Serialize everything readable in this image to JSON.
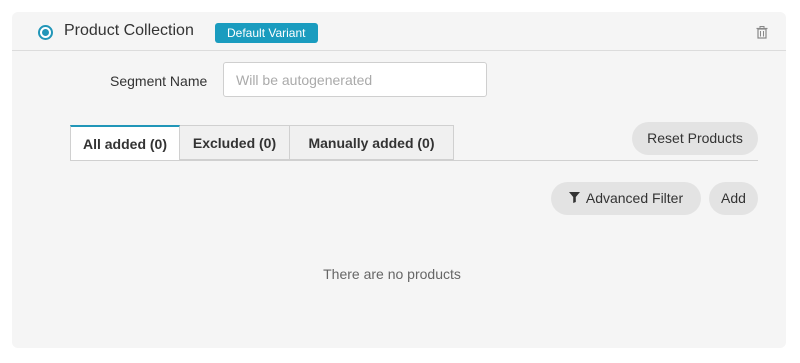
{
  "header": {
    "title": "Product Collection",
    "badge": "Default Variant",
    "radio_selected": true,
    "delete_icon": "trash-icon"
  },
  "segment": {
    "label": "Segment Name",
    "value": "",
    "placeholder": "Will be autogenerated"
  },
  "tabs": [
    {
      "label": "All added (0)",
      "active": true
    },
    {
      "label": "Excluded (0)",
      "active": false
    },
    {
      "label": "Manually added (0)",
      "active": false
    }
  ],
  "actions": {
    "reset_label": "Reset Products",
    "filter_label": "Advanced Filter",
    "filter_icon": "filter-icon",
    "add_label": "Add"
  },
  "empty_message": "There are no products",
  "colors": {
    "accent": "#1a9cbf",
    "card_bg": "#f5f5f5",
    "button_bg": "#e3e3e3"
  }
}
